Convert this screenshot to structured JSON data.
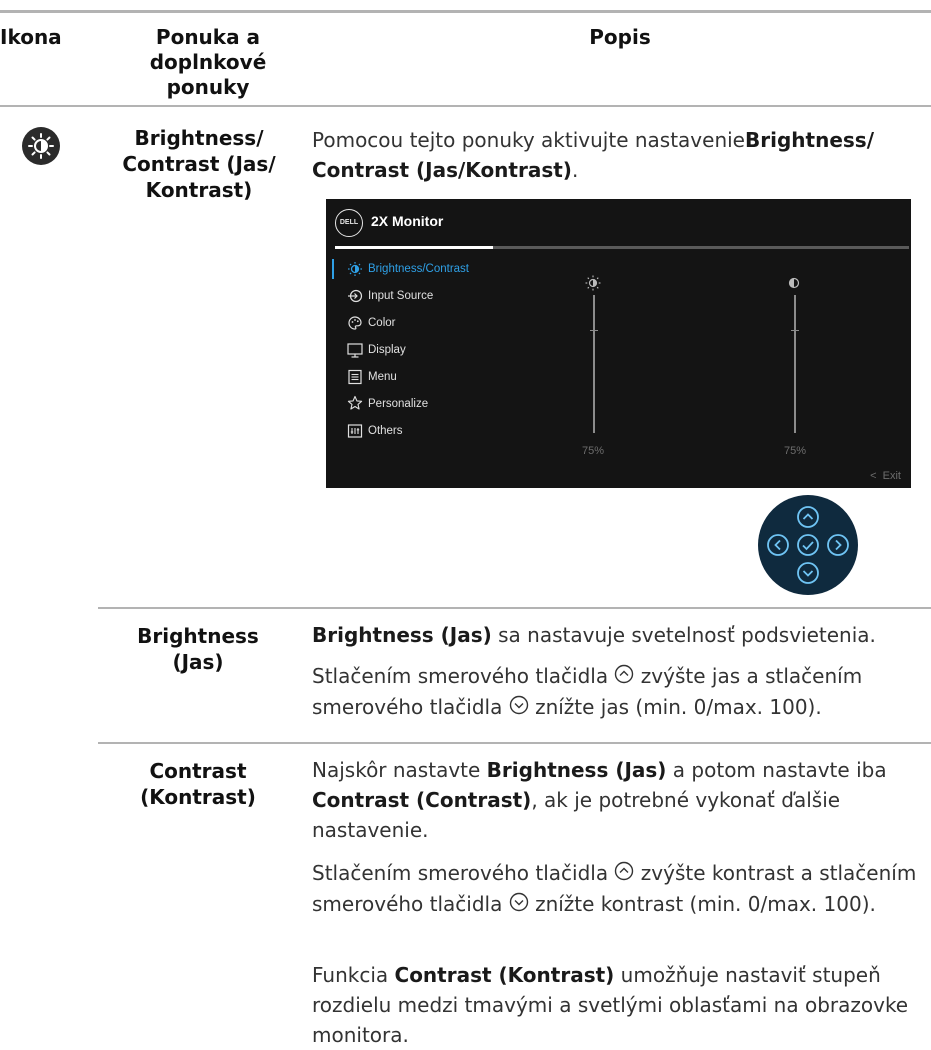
{
  "header": {
    "icon_col": "Ikona",
    "menu_col": "Ponuka a doplnkové ponuky",
    "desc_col": "Popis"
  },
  "row_main": {
    "menu_label": "Brightness/ Contrast (Jas/ Kontrast)",
    "desc_prefix": "Pomocou tejto ponuky aktivujte nastavenie",
    "desc_bold": "Brightness/ Contrast (Jas/Kontrast)",
    "desc_suffix": "."
  },
  "osd": {
    "logo": "DELL",
    "title": "2X Monitor",
    "menu_items": [
      {
        "icon": "brightness-icon",
        "label": "Brightness/Contrast",
        "active": true
      },
      {
        "icon": "input-source-icon",
        "label": "Input Source"
      },
      {
        "icon": "color-palette-icon",
        "label": "Color"
      },
      {
        "icon": "display-monitor-icon",
        "label": "Display"
      },
      {
        "icon": "menu-list-icon",
        "label": "Menu"
      },
      {
        "icon": "star-icon",
        "label": "Personalize"
      },
      {
        "icon": "others-icon",
        "label": "Others"
      }
    ],
    "brightness_value": "75%",
    "contrast_value": "75%",
    "exit_label": "Exit",
    "colors": {
      "background": "#141414",
      "accent": "#2fa0e6"
    }
  },
  "joystick": {
    "buttons": [
      "up-arrow-icon",
      "left-arrow-icon",
      "confirm-check-icon",
      "right-arrow-icon",
      "down-arrow-icon"
    ],
    "background": "#0f2a3e"
  },
  "brightness_row": {
    "label": "Brightness (Jas)",
    "p1_bold": "Brightness (Jas)",
    "p1_rest": " sa nastavuje svetelnosť podsvietenia.",
    "p2_a": "Stlačením smerového tlačidla ",
    "p2_b": " zvýšte jas a stlačením smerového tlačidla ",
    "p2_c": " znížte jas (min. 0/max. 100)."
  },
  "contrast_row": {
    "label": "Contrast (Kontrast)",
    "p1_a": "Najskôr nastavte ",
    "p1_bold1": "Brightness (Jas)",
    "p1_b": " a potom nastavte iba ",
    "p1_bold2": "Contrast (Contrast)",
    "p1_c": ", ak je potrebné vykonať ďalšie nastavenie.",
    "p2_a": "Stlačením smerového tlačidla ",
    "p2_b": " zvýšte kontrast a stlačením smerového tlačidla ",
    "p2_c": " znížte kontrast (min. 0/max. 100).",
    "p3_a": "Funkcia ",
    "p3_bold": "Contrast (Kontrast)",
    "p3_b": " umožňuje nastaviť stupeň rozdielu medzi tmavými a svetlými oblasťami na obrazovke monitora."
  }
}
